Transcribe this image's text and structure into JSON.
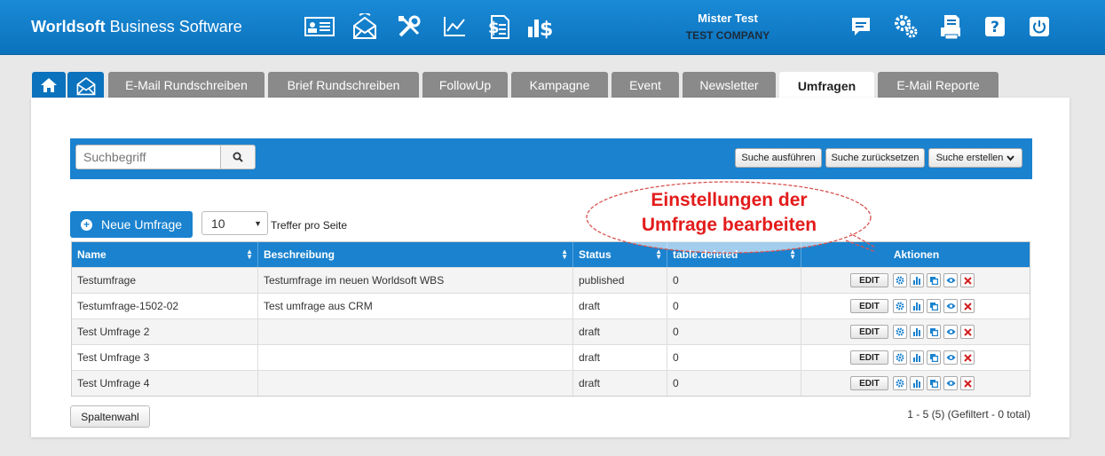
{
  "header": {
    "brand_bold": "Worldsoft",
    "brand_rest": " Business Software",
    "user_name": "Mister Test",
    "company": "TEST COMPANY",
    "left_icons": [
      "contacts-card-icon",
      "mail-campaign-icon",
      "tools-icon",
      "chart-line-icon",
      "document-dollar-icon",
      "bar-dollar-icon"
    ],
    "right_icons": [
      "chat-icon",
      "settings-gears-icon",
      "print-icon",
      "help-icon",
      "power-icon"
    ]
  },
  "tabs": [
    {
      "label": "E-Mail Rundschreiben"
    },
    {
      "label": "Brief Rundschreiben"
    },
    {
      "label": "FollowUp"
    },
    {
      "label": "Kampagne"
    },
    {
      "label": "Event"
    },
    {
      "label": "Newsletter"
    },
    {
      "label": "Umfragen",
      "active": true
    },
    {
      "label": "E-Mail Reporte"
    }
  ],
  "search": {
    "placeholder": "Suchbegriff",
    "run_label": "Suche ausführen",
    "reset_label": "Suche zurücksetzen",
    "create_label": "Suche erstellen"
  },
  "toolbar": {
    "new_label": "Neue Umfrage",
    "per_page_value": "10",
    "per_page_label": "Treffer pro Seite"
  },
  "table": {
    "columns": [
      "Name",
      "Beschreibung",
      "Status",
      "table.deleted",
      "Aktionen"
    ],
    "rows": [
      {
        "name": "Testumfrage",
        "description": "Testumfrage im neuen Worldsoft WBS",
        "status": "published",
        "deleted": "0"
      },
      {
        "name": "Testumfrage-1502-02",
        "description": "Test umfrage aus CRM",
        "status": "draft",
        "deleted": "0"
      },
      {
        "name": "Test Umfrage 2",
        "description": "",
        "status": "draft",
        "deleted": "0"
      },
      {
        "name": "Test Umfrage 3",
        "description": "",
        "status": "draft",
        "deleted": "0"
      },
      {
        "name": "Test Umfrage 4",
        "description": "",
        "status": "draft",
        "deleted": "0"
      }
    ],
    "edit_label": "EDIT"
  },
  "footer": {
    "columns_button": "Spaltenwahl",
    "page_info": "1 - 5 (5) (Gefiltert - 0 total)"
  },
  "callout": {
    "line1": "Einstellungen der",
    "line2": "Umfrage bearbeiten"
  },
  "colors": {
    "header_blue": "#0b72bd",
    "accent_blue": "#1a82cf",
    "callout_red": "#e31b1b"
  }
}
